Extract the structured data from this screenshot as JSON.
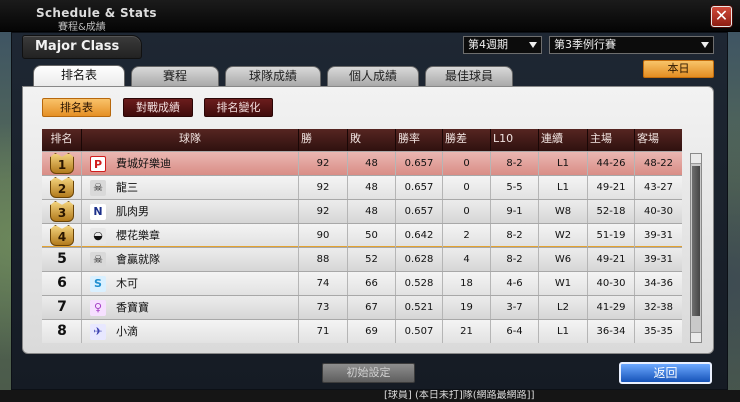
{
  "window": {
    "title_en": "Schedule & Stats",
    "title_zh": "賽程&成績",
    "close_glyph": "✕"
  },
  "class_label": "Major Class",
  "week_select": {
    "value": "第4週期"
  },
  "season_select": {
    "value": "第3季例行賽"
  },
  "today_button": "本日",
  "tabs": [
    {
      "label": "排名表",
      "active": true
    },
    {
      "label": "賽程",
      "active": false
    },
    {
      "label": "球隊成績",
      "active": false
    },
    {
      "label": "個人成績",
      "active": false
    },
    {
      "label": "最佳球員",
      "active": false
    }
  ],
  "subtabs": [
    {
      "label": "排名表",
      "active": true
    },
    {
      "label": "對戰成績",
      "active": false
    },
    {
      "label": "排名變化",
      "active": false
    }
  ],
  "table": {
    "headers": [
      "排名",
      "球隊",
      "勝",
      "敗",
      "勝率",
      "勝差",
      "L10",
      "連續",
      "主場",
      "客場"
    ],
    "rows": [
      {
        "rank": "1",
        "team": "費城好樂迪",
        "logo": "P",
        "w": "92",
        "l": "48",
        "pct": "0.657",
        "gb": "0",
        "l10": "8-2",
        "strk": "L1",
        "home": "44-26",
        "away": "48-22"
      },
      {
        "rank": "2",
        "team": "龍三",
        "logo": "☠",
        "w": "92",
        "l": "48",
        "pct": "0.657",
        "gb": "0",
        "l10": "5-5",
        "strk": "L1",
        "home": "49-21",
        "away": "43-27"
      },
      {
        "rank": "3",
        "team": "肌肉男",
        "logo": "N",
        "w": "92",
        "l": "48",
        "pct": "0.657",
        "gb": "0",
        "l10": "9-1",
        "strk": "W8",
        "home": "52-18",
        "away": "40-30"
      },
      {
        "rank": "4",
        "team": "櫻花樂章",
        "logo": "◒",
        "w": "90",
        "l": "50",
        "pct": "0.642",
        "gb": "2",
        "l10": "8-2",
        "strk": "W2",
        "home": "51-19",
        "away": "39-31"
      },
      {
        "rank": "5",
        "team": "會贏就隊",
        "logo": "☠",
        "w": "88",
        "l": "52",
        "pct": "0.628",
        "gb": "4",
        "l10": "8-2",
        "strk": "W6",
        "home": "49-21",
        "away": "39-31"
      },
      {
        "rank": "6",
        "team": "木可",
        "logo": "S",
        "w": "74",
        "l": "66",
        "pct": "0.528",
        "gb": "18",
        "l10": "4-6",
        "strk": "W1",
        "home": "40-30",
        "away": "34-36"
      },
      {
        "rank": "7",
        "team": "香寶寶",
        "logo": "♀",
        "w": "73",
        "l": "67",
        "pct": "0.521",
        "gb": "19",
        "l10": "3-7",
        "strk": "L2",
        "home": "41-29",
        "away": "32-38"
      },
      {
        "rank": "8",
        "team": "小滴",
        "logo": "✈",
        "w": "71",
        "l": "69",
        "pct": "0.507",
        "gb": "21",
        "l10": "6-4",
        "strk": "L1",
        "home": "36-34",
        "away": "35-35"
      }
    ]
  },
  "buttons": {
    "init": "初始設定",
    "back": "返回"
  },
  "ticker": "[球員] (本日未打]隊(網路最網路]]",
  "colors": {
    "accent": "#e58f25",
    "header": "#4a1f1b",
    "highlight_row": "#e3a7a2",
    "back": "#1653b8"
  }
}
